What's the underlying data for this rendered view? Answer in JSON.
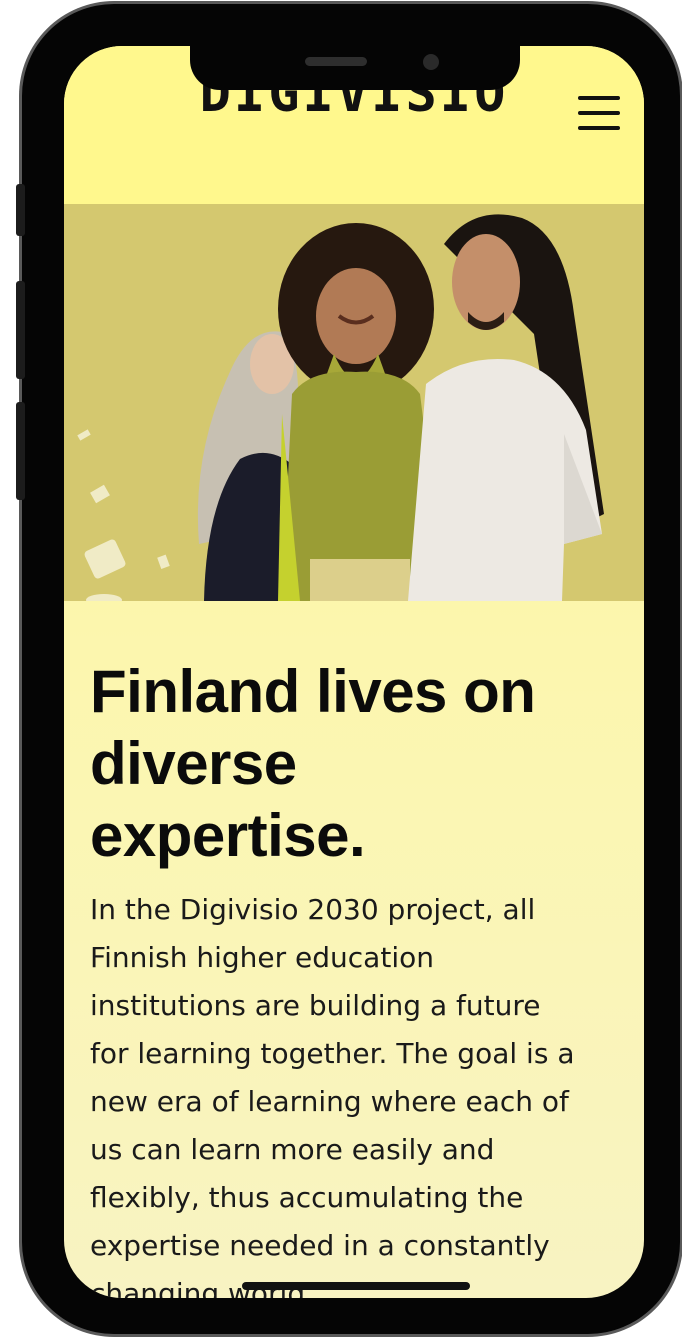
{
  "header": {
    "logo_text": "DIGIVISIO",
    "menu_icon": "hamburger-menu-icon"
  },
  "hero": {
    "image_content": "photo-three-people",
    "background_color": "#cfc369"
  },
  "main": {
    "headline_lines": [
      "Finland lives on",
      "diverse",
      "expertise."
    ],
    "body_lines": [
      "In the Digivisio 2030 project, all",
      "Finnish higher education",
      "institutions are building a future",
      "for learning together. The goal is a",
      "new era of learning where each of",
      "us can learn more easily and",
      "flexibly, thus accumulating the",
      "expertise needed in a constantly",
      "changing world."
    ]
  },
  "colors": {
    "header_bg": "#fff88d",
    "page_bg": "#fbf6b3",
    "text": "#0b0b0b",
    "frame": "#050505"
  }
}
